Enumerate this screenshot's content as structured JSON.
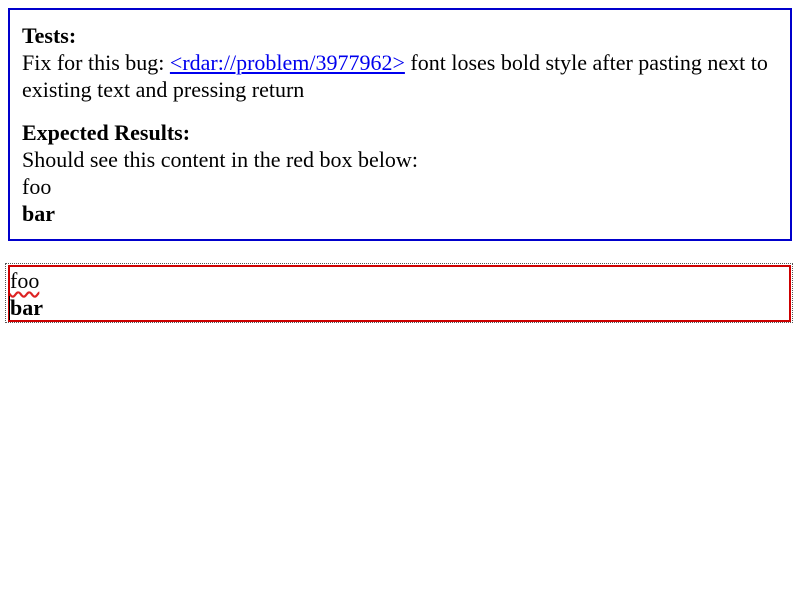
{
  "explanation": {
    "tests_heading": "Tests:",
    "tests_text_before": "Fix for this bug: ",
    "bug_link_text": "<rdar://problem/3977962>",
    "tests_text_after": " font loses bold style after pasting next to existing text and pressing return",
    "expected_heading": "Expected Results:",
    "expected_text": "Should see this content in the red box below:",
    "expected_line1": "foo",
    "expected_line2": "bar"
  },
  "editor": {
    "line1": "foo",
    "line2": "bar"
  },
  "colors": {
    "explanation_border": "#0000cc",
    "editor_border": "#cc0000",
    "link": "#0000ee",
    "spellcheck": "#dd2222"
  }
}
